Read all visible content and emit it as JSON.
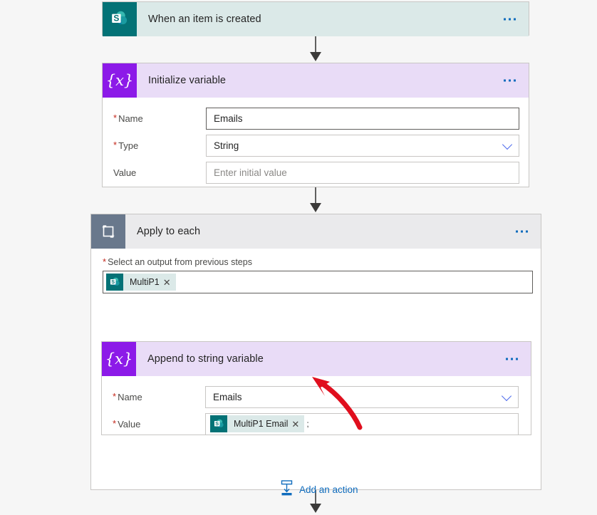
{
  "canvas": {
    "background_color": "#f6f6f6",
    "accent_blue": "#0f6cbd",
    "required_red": "#c4281c",
    "annotation_color": "#e00f1e"
  },
  "trigger": {
    "title": "When an item is created",
    "icon": "sharepoint-icon",
    "icon_letter": "S",
    "header_color": "#dbe9e8",
    "tile_color": "#047276",
    "menu": "…"
  },
  "initialize_variable": {
    "title": "Initialize variable",
    "icon": "variable-icon",
    "icon_glyph": "{x}",
    "header_color": "#e9dcf7",
    "tile_color": "#8c1ae8",
    "fields": [
      {
        "label": "Name",
        "required": true,
        "value": "Emails",
        "placeholder": "",
        "control": "text"
      },
      {
        "label": "Type",
        "required": true,
        "value": "String",
        "placeholder": "",
        "control": "dropdown"
      },
      {
        "label": "Value",
        "required": false,
        "value": "",
        "placeholder": "Enter initial value",
        "control": "text"
      }
    ]
  },
  "apply_to_each": {
    "title": "Apply to each",
    "icon": "loop-icon",
    "header_color": "#eaeaec",
    "tile_color": "#69788c",
    "input_label": "Select an output from previous steps",
    "input_required": true,
    "token": {
      "label": "MultiP1",
      "icon": "sharepoint-icon",
      "icon_letter": "S",
      "remove": "✕"
    },
    "add_action": {
      "label": "Add an action",
      "icon": "insert-action-icon"
    }
  },
  "append_to_string": {
    "title": "Append to string variable",
    "icon": "variable-icon",
    "icon_glyph": "{x}",
    "header_color": "#e9dcf7",
    "tile_color": "#8c1ae8",
    "fields": [
      {
        "label": "Name",
        "required": true,
        "value": "Emails",
        "control": "dropdown"
      },
      {
        "label": "Value",
        "required": true,
        "control": "token"
      }
    ],
    "value_token": {
      "label": "MultiP1 Email",
      "icon": "sharepoint-icon",
      "icon_letter": "S",
      "remove": "✕"
    },
    "value_trailing_text": ";"
  }
}
